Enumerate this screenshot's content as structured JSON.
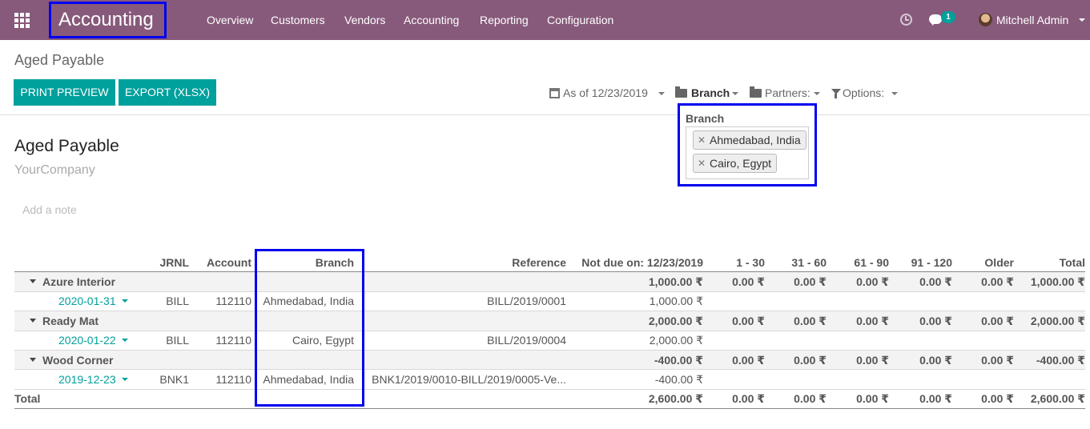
{
  "navbar": {
    "brand": "Accounting",
    "menu": [
      "Overview",
      "Customers",
      "Vendors",
      "Accounting",
      "Reporting",
      "Configuration"
    ],
    "messages_badge": "1",
    "user": "Mitchell Admin"
  },
  "control_panel": {
    "title": "Aged Payable",
    "print_button": "PRINT PREVIEW",
    "export_button": "EXPORT (XLSX)",
    "date_filter": "As of 12/23/2019",
    "branch_filter": "Branch",
    "partners_filter": "Partners:",
    "options_filter": "Options:"
  },
  "branch_dropdown": {
    "title": "Branch",
    "tags": [
      "Ahmedabad, India",
      "Cairo, Egypt"
    ]
  },
  "report": {
    "title": "Aged Payable",
    "company": "YourCompany",
    "note_placeholder": "Add a note"
  },
  "table": {
    "headers": {
      "jrnl": "JRNL",
      "account": "Account",
      "branch": "Branch",
      "reference": "Reference",
      "not_due": "Not due on: 12/23/2019",
      "b1_30": "1 - 30",
      "b31_60": "31 - 60",
      "b61_90": "61 - 90",
      "b91_120": "91 - 120",
      "older": "Older",
      "total": "Total"
    },
    "groups": [
      {
        "name": "Azure Interior",
        "not_due": "1,000.00 ₹",
        "b1_30": "0.00 ₹",
        "b31_60": "0.00 ₹",
        "b61_90": "0.00 ₹",
        "b91_120": "0.00 ₹",
        "older": "0.00 ₹",
        "total": "1,000.00 ₹",
        "line": {
          "date": "2020-01-31",
          "jrnl": "BILL",
          "account": "112110",
          "branch": "Ahmedabad, India",
          "reference": "BILL/2019/0001",
          "not_due": "1,000.00 ₹"
        }
      },
      {
        "name": "Ready Mat",
        "not_due": "2,000.00 ₹",
        "b1_30": "0.00 ₹",
        "b31_60": "0.00 ₹",
        "b61_90": "0.00 ₹",
        "b91_120": "0.00 ₹",
        "older": "0.00 ₹",
        "total": "2,000.00 ₹",
        "line": {
          "date": "2020-01-22",
          "jrnl": "BILL",
          "account": "112110",
          "branch": "Cairo, Egypt",
          "reference": "BILL/2019/0004",
          "not_due": "2,000.00 ₹"
        }
      },
      {
        "name": "Wood Corner",
        "not_due": "-400.00 ₹",
        "b1_30": "0.00 ₹",
        "b31_60": "0.00 ₹",
        "b61_90": "0.00 ₹",
        "b91_120": "0.00 ₹",
        "older": "0.00 ₹",
        "total": "-400.00 ₹",
        "line": {
          "date": "2019-12-23",
          "jrnl": "BNK1",
          "account": "112110",
          "branch": "Ahmedabad, India",
          "reference": "BNK1/2019/0010-BILL/2019/0005-Ve...",
          "not_due": "-400.00 ₹"
        }
      }
    ],
    "total": {
      "label": "Total",
      "not_due": "2,600.00 ₹",
      "b1_30": "0.00 ₹",
      "b31_60": "0.00 ₹",
      "b61_90": "0.00 ₹",
      "b91_120": "0.00 ₹",
      "older": "0.00 ₹",
      "total": "2,600.00 ₹"
    }
  },
  "colors": {
    "navbar": "#875a7b",
    "primary": "#00a09d",
    "highlight": "#0000ee"
  }
}
